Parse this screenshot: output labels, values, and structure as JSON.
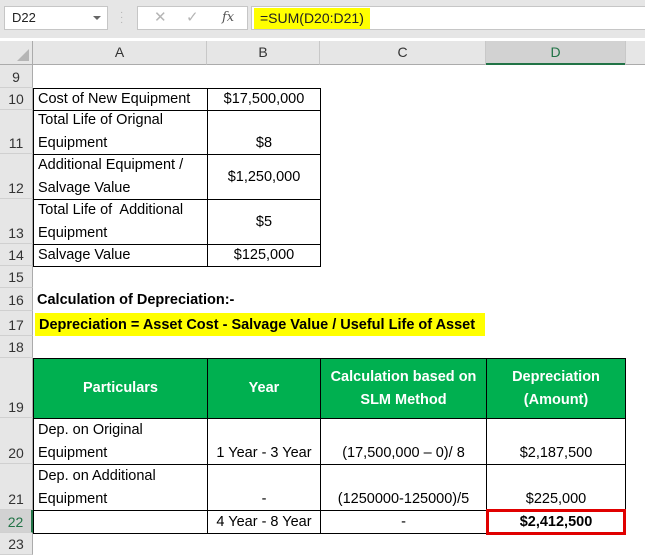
{
  "formula_bar": {
    "name_box": "D22",
    "cancel_icon": "x-icon",
    "enter_icon": "check-icon",
    "function_label": "fx",
    "formula": "=SUM(D20:D21)"
  },
  "columns": [
    "A",
    "B",
    "C",
    "D"
  ],
  "selected_column": "D",
  "rows": [
    "9",
    "10",
    "11",
    "12",
    "13",
    "14",
    "15",
    "16",
    "17",
    "18",
    "19",
    "20",
    "21",
    "22",
    "23"
  ],
  "selected_row": "22",
  "inputs_table": [
    {
      "label_lines": [
        "Cost of New Equipment"
      ],
      "value": "$17,500,000"
    },
    {
      "label_lines": [
        "Total Life of Orignal",
        "Equipment"
      ],
      "value": "$8"
    },
    {
      "label_lines": [
        "Additional Equipment /",
        "Salvage Value"
      ],
      "value": "$1,250,000"
    },
    {
      "label_lines": [
        "Total Life of  Additional",
        "Equipment"
      ],
      "value": "$5"
    },
    {
      "label_lines": [
        "Salvage Value"
      ],
      "value": "$125,000"
    }
  ],
  "section_title": "Calculation of Depreciation:-",
  "formula_note": "Depreciation = Asset Cost - Salvage Value / Useful Life of Asset",
  "dep_table": {
    "header": {
      "particulars": "Particulars",
      "year": "Year",
      "calc_lines": [
        "Calculation based on",
        "SLM Method"
      ],
      "dep_lines": [
        "Depreciation",
        "(Amount)"
      ]
    },
    "rows": [
      {
        "particulars_lines": [
          "Dep. on Original",
          "Equipment"
        ],
        "year": "1 Year - 3 Year",
        "calc": "(17,500,000 – 0)/ 8",
        "amount": "$2,187,500"
      },
      {
        "particulars_lines": [
          "Dep. on Additional",
          "Equipment"
        ],
        "year": "-",
        "calc": "(1250000-125000)/5",
        "amount": "$225,000"
      },
      {
        "particulars_lines": [
          ""
        ],
        "year": "4 Year - 8 Year",
        "calc": "-",
        "amount": "$2,412,500"
      }
    ]
  },
  "colors": {
    "header_green": "#00b050",
    "highlight_yellow": "#ffff00",
    "selection_red": "#e00000",
    "excel_green": "#217346"
  }
}
